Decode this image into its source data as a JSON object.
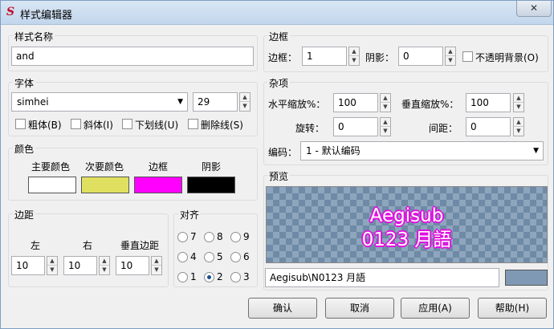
{
  "title": "样式编辑器",
  "close_symbol": "✕",
  "style_name": {
    "title": "样式名称",
    "value": "and"
  },
  "font": {
    "title": "字体",
    "family": "simhei",
    "size": "29",
    "bold": "粗体(B)",
    "italic": "斜体(I)",
    "underline": "下划线(U)",
    "strikeout": "删除线(S)"
  },
  "colors": {
    "title": "颜色",
    "primary": {
      "label": "主要颜色",
      "color": "#ffffff"
    },
    "secondary": {
      "label": "次要颜色",
      "color": "#e0e060"
    },
    "outline": {
      "label": "边框",
      "color": "#ff00ff"
    },
    "shadow": {
      "label": "阴影",
      "color": "#000000"
    }
  },
  "margins": {
    "title": "边距",
    "left_label": "左",
    "left": "10",
    "right_label": "右",
    "right": "10",
    "vert_label": "垂直边距",
    "vert": "10"
  },
  "alignment": {
    "title": "对齐",
    "options": [
      "7",
      "8",
      "9",
      "4",
      "5",
      "6",
      "1",
      "2",
      "3"
    ],
    "selected": "2"
  },
  "border": {
    "title": "边框",
    "outline_label": "边框：",
    "outline": "1",
    "shadow_label": "阴影：",
    "shadow": "0",
    "opaque_label": "不透明背景(O)"
  },
  "misc": {
    "title": "杂项",
    "scale_x_label": "水平缩放%：",
    "scale_x": "100",
    "scale_y_label": "垂直缩放%：",
    "scale_y": "100",
    "angle_label": "旋转：",
    "angle": "0",
    "spacing_label": "间距：",
    "spacing": "0",
    "encoding_label": "编码：",
    "encoding": "1 - 默认编码"
  },
  "preview": {
    "title": "预览",
    "line1": "Aegisub",
    "line2": "0123 月語",
    "text": "Aegisub\\N0123 月語",
    "bg_color": "#7f99b5"
  },
  "buttons": {
    "ok": "确认",
    "cancel": "取消",
    "apply": "应用(A)",
    "help": "帮助(H)"
  }
}
